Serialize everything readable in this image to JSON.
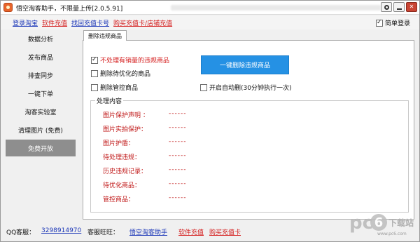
{
  "window": {
    "title": "悟空淘客助手，不限量上传[2.0.5.91]"
  },
  "topbar": {
    "links": [
      {
        "label": "登录淘宝",
        "color": "blue"
      },
      {
        "label": "软件充值",
        "color": "red"
      },
      {
        "label": "找回充值卡号",
        "color": "blue"
      },
      {
        "label": "购买充值卡/店铺充值",
        "color": "red"
      }
    ],
    "simple_login_label": "简单登录",
    "simple_login_checked": true
  },
  "sidebar": {
    "items": [
      {
        "label": "数据分析",
        "active": false
      },
      {
        "label": "发布商品",
        "active": false
      },
      {
        "label": "排查同步",
        "active": false
      },
      {
        "label": "一键下单",
        "active": false
      },
      {
        "label": "淘客实验室",
        "active": false
      },
      {
        "label": "清理图片 (免费)",
        "active": false
      },
      {
        "label": "免费开放",
        "active": true
      }
    ]
  },
  "tab": {
    "label": "删除违规商品"
  },
  "options": {
    "skip_sold": {
      "label": "不处理有销量的违规商品",
      "checked": true
    },
    "delete_pending": {
      "label": "删除待优化的商品",
      "checked": false
    },
    "delete_controlled": {
      "label": "删除管控商品",
      "checked": false
    },
    "auto_delete": {
      "label": "开启自动删(30分钟执行一次)",
      "checked": false
    }
  },
  "delete_button_label": "一键删除违规商品",
  "process": {
    "title": "处理内容",
    "rows": [
      {
        "label": "图片保护声明 ：",
        "value": "------"
      },
      {
        "label": "图片实拍保护：",
        "value": "------"
      },
      {
        "label": "图片护盾：",
        "value": "------"
      },
      {
        "label": "待处理违规：",
        "value": "------"
      },
      {
        "label": "历史违规记录：",
        "value": "------"
      },
      {
        "label": "待优化商品：",
        "value": "------"
      },
      {
        "label": "管控商品：",
        "value": "------"
      }
    ]
  },
  "footer": {
    "qq_label": "QQ客服：",
    "qq_number": "3298914970",
    "wangwang_label": "客服旺旺：",
    "wangwang_name": "悟空淘客助手",
    "recharge_label": "软件充值",
    "buy_card_label": "购买充值卡"
  },
  "watermark": {
    "brand_letters": "pc",
    "brand_digit": "6",
    "brand_cn": "下载站",
    "url": "www.pc6.com"
  },
  "colors": {
    "accent_blue": "#2591e4",
    "alert_red": "#d41c1c",
    "link_blue": "#1c37b8",
    "active_nav": "#8e8e8e"
  }
}
